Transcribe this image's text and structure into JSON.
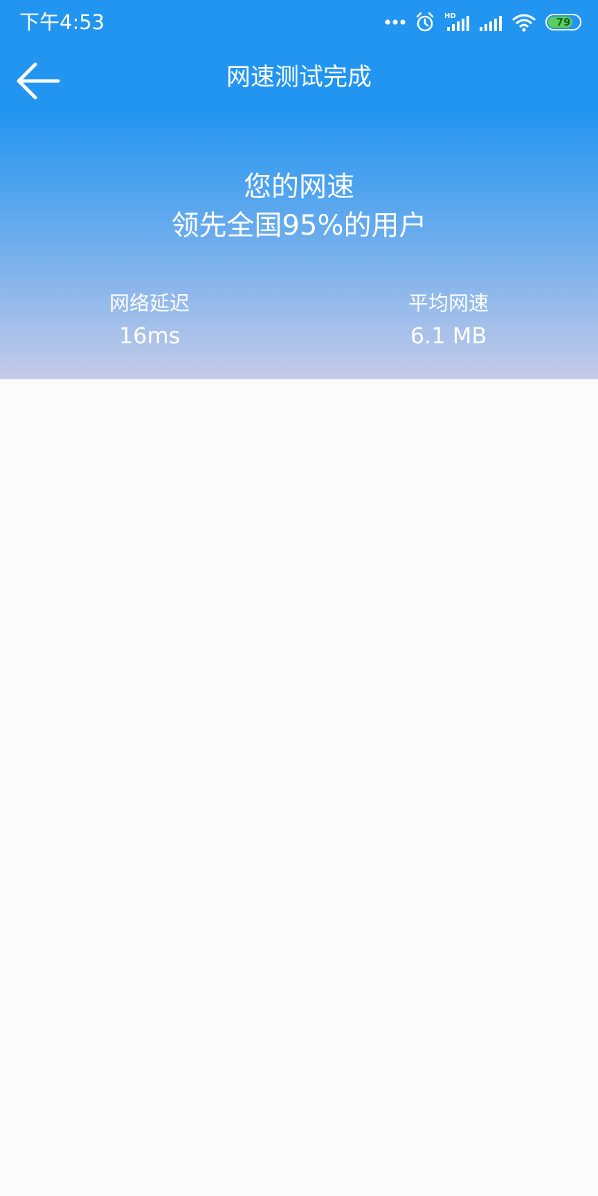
{
  "status_bar": {
    "time": "下午4:53",
    "battery_level": "79",
    "battery_fraction": 0.79,
    "icons": [
      "more-dots-icon",
      "alarm-icon",
      "hd-signal-icon",
      "signal-icon",
      "wifi-icon",
      "battery-icon"
    ],
    "hd_label": "HD"
  },
  "app_bar": {
    "title": "网速测试完成",
    "back_icon": "arrow-left-icon"
  },
  "result": {
    "headline_line1": "您的网速",
    "headline_line2": "领先全国95%的用户"
  },
  "stats": {
    "latency_label": "网络延迟",
    "latency_value": "16ms",
    "speed_label": "平均网速",
    "speed_value": "6.1 MB"
  },
  "colors": {
    "header_top": "#2295f1",
    "header_bottom": "#c5cae9",
    "background": "#fbfbfb",
    "text": "#ffffff",
    "battery_fill": "#5bd05b"
  }
}
